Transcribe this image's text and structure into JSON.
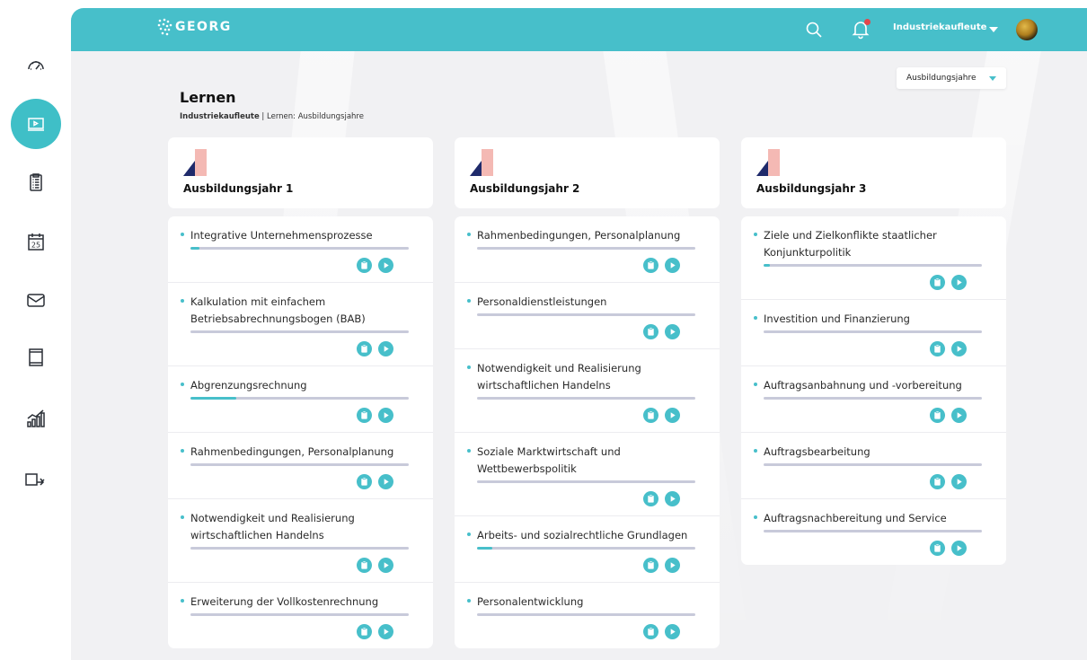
{
  "header": {
    "logo_text": "GEORG",
    "user_name": "Industriekaufleute"
  },
  "sidebar": {
    "items": [
      {
        "icon": "dashboard-gauge-icon",
        "active": false
      },
      {
        "icon": "learning-screen-icon",
        "active": true
      },
      {
        "icon": "clipboard-checklist-icon",
        "active": false
      },
      {
        "icon": "calendar-icon",
        "active": false,
        "day": "25"
      },
      {
        "icon": "mail-icon",
        "active": false
      },
      {
        "icon": "book-icon",
        "active": false
      },
      {
        "icon": "statistics-chart-icon",
        "active": false
      },
      {
        "icon": "board-pointer-icon",
        "active": false
      }
    ]
  },
  "filter": {
    "label": "Ausbildungsjahre"
  },
  "page": {
    "title": "Lernen",
    "breadcrumb_bold": "Industriekaufleute",
    "breadcrumb_rest": " | Lernen: Ausbildungsjahre"
  },
  "colors": {
    "accent": "#47bfca",
    "track": "#c8cada",
    "logo_dark": "#1f2a6b",
    "logo_light": "#f4b9b4"
  },
  "years": [
    {
      "title": "Ausbildungsjahr 1",
      "topics": [
        {
          "title": "Integrative Unternehmensprozesse",
          "progress": 0.04
        },
        {
          "title": "Kalkulation mit einfachem Betriebsabrechnungsbogen (BAB)",
          "progress": 0
        },
        {
          "title": "Abgrenzungsrechnung",
          "progress": 0.21
        },
        {
          "title": "Rahmenbedingungen, Personalplanung",
          "progress": 0
        },
        {
          "title": "Notwendigkeit und Realisierung wirtschaftlichen Handelns",
          "progress": 0
        },
        {
          "title": "Erweiterung der Vollkostenrechnung",
          "progress": 0
        }
      ]
    },
    {
      "title": "Ausbildungsjahr 2",
      "topics": [
        {
          "title": "Rahmenbedingungen, Personalplanung",
          "progress": 0
        },
        {
          "title": "Personaldienstleistungen",
          "progress": 0
        },
        {
          "title": "Notwendigkeit und Realisierung wirtschaftlichen Handelns",
          "progress": 0
        },
        {
          "title": "Soziale Marktwirtschaft und Wettbewerbspolitik",
          "progress": 0
        },
        {
          "title": "Arbeits- und sozialrechtliche Grundlagen",
          "progress": 0.07
        },
        {
          "title": "Personalentwicklung",
          "progress": 0
        }
      ]
    },
    {
      "title": "Ausbildungsjahr 3",
      "topics": [
        {
          "title": "Ziele und Zielkonflikte staatlicher Konjunkturpolitik",
          "progress": 0.03
        },
        {
          "title": "Investition und Finanzierung",
          "progress": 0
        },
        {
          "title": "Auftragsanbahnung und -vorbereitung",
          "progress": 0
        },
        {
          "title": "Auftragsbearbeitung",
          "progress": 0
        },
        {
          "title": "Auftragsnachbereitung und Service",
          "progress": 0
        }
      ]
    }
  ]
}
